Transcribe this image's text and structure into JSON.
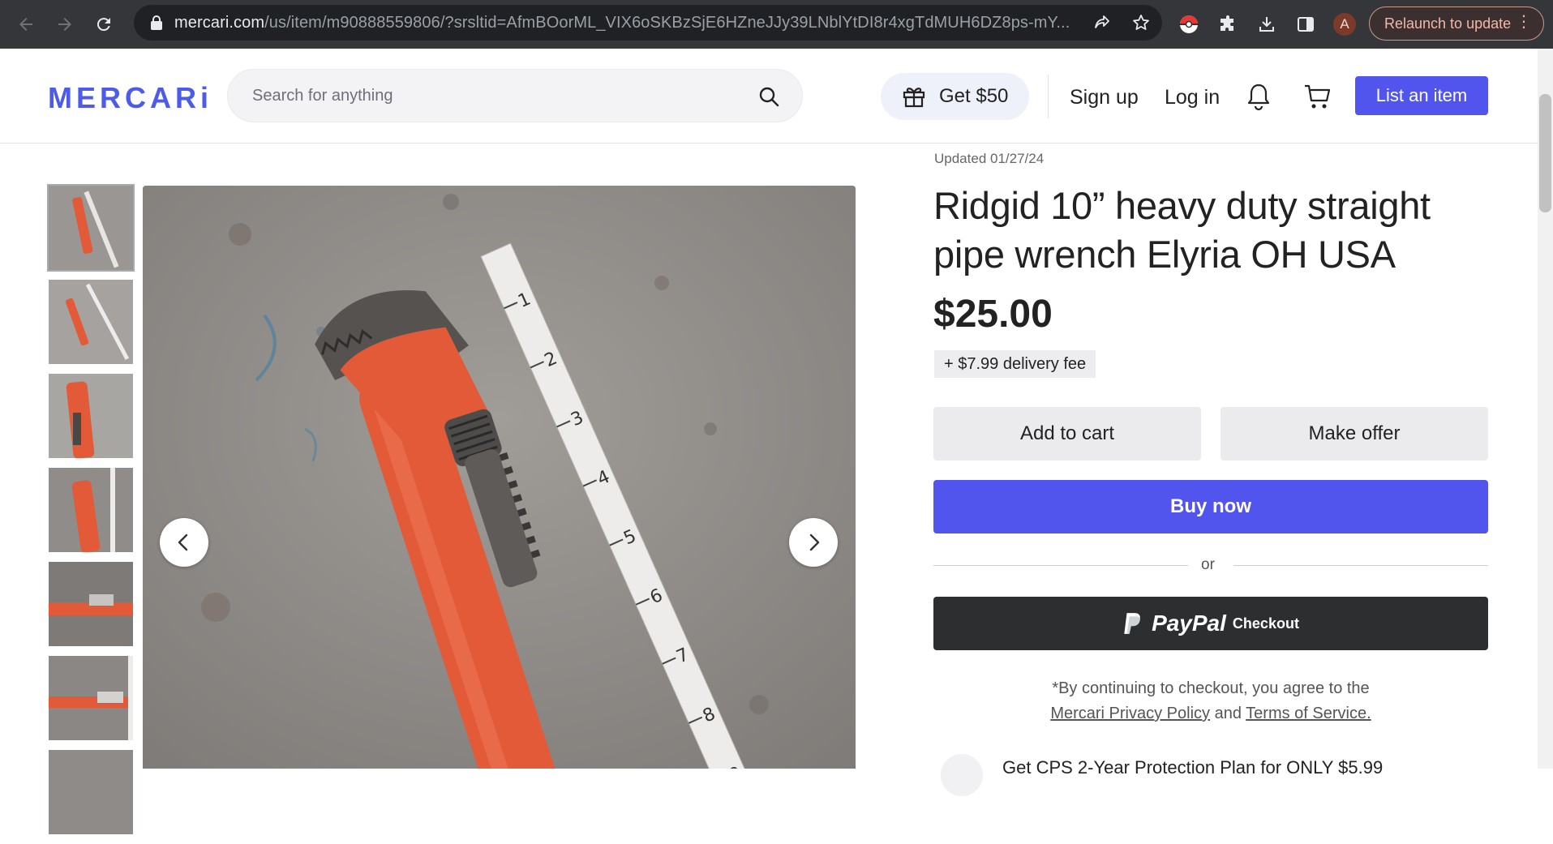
{
  "browser": {
    "url_host": "mercari.com",
    "url_rest": "/us/item/m90888559806/?srsltid=AfmBOorML_VIX6oSKBzSjE6HZneJJy39LNblYtDI8r4xgTdMUH6DZ8ps-mY...",
    "profile_initial": "A",
    "relaunch_label": "Relaunch to update",
    "icons": [
      "back-arrow-icon",
      "forward-arrow-icon",
      "reload-icon",
      "lock-icon",
      "share-icon",
      "star-icon",
      "pokeball-extension-icon",
      "puzzle-extensions-icon",
      "download-icon",
      "side-panel-icon",
      "more-vert-icon"
    ]
  },
  "header": {
    "logo": "MERCARi",
    "search_placeholder": "Search for anything",
    "get_label": "Get $50",
    "signup_label": "Sign up",
    "login_label": "Log in",
    "list_item_label": "List an item",
    "icons": [
      "search-icon",
      "gift-icon",
      "bell-icon",
      "cart-icon"
    ]
  },
  "gallery": {
    "thumbnail_count": 7,
    "active_thumbnail": 1,
    "prev_icon": "chevron-left-icon",
    "next_icon": "chevron-right-icon"
  },
  "item": {
    "updated": "Updated 01/27/24",
    "title": "Ridgid 10” heavy duty straight pipe wrench Elyria OH USA",
    "price": "$25.00",
    "delivery_fee": "+ $7.99 delivery fee"
  },
  "actions": {
    "add_to_cart": "Add to cart",
    "make_offer": "Make offer",
    "buy_now": "Buy now",
    "or": "or",
    "paypal_word": "PayPal",
    "paypal_checkout": "Checkout"
  },
  "consent": {
    "prefix": "*By continuing to checkout, you agree to the",
    "privacy_link": "Mercari Privacy Policy",
    "and": "and",
    "terms_link": "Terms of Service."
  },
  "protection": {
    "text": "Get CPS 2-Year Protection Plan for ONLY $5.99"
  },
  "colors": {
    "brand": "#4d5bea",
    "buy_button": "#5155ed",
    "paypal_button": "#2c2e2f",
    "chrome_bar": "#35363a",
    "wrench_orange": "#e25a38"
  }
}
